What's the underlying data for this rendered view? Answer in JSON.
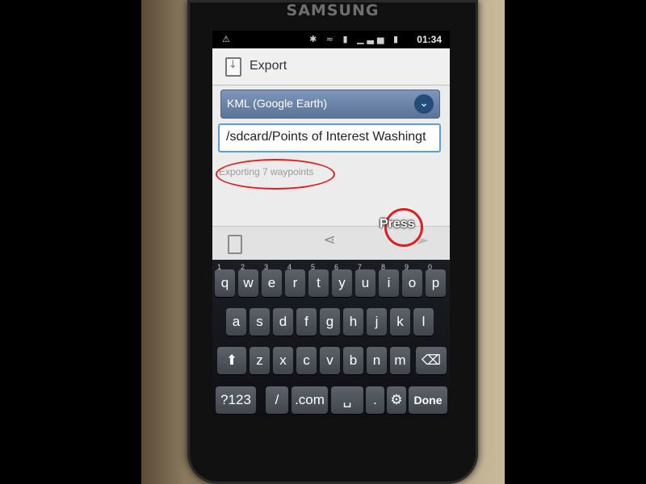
{
  "device": {
    "brand": "SAMSUNG"
  },
  "statusbar": {
    "warning": "⚠",
    "icons": "✱ ≈ ▮ ▁▃▅ ▮",
    "time": "01:34"
  },
  "dialog": {
    "title": "Export",
    "format_select": "KML (Google Earth)",
    "path_value": "/sdcard/Points of Interest Washingt",
    "status": "Exporting 7 waypoints"
  },
  "actions": {
    "share_icon": "⋖",
    "next_icon": "►"
  },
  "annotation": {
    "press_label": "Press",
    "highlight_color": "#e02020"
  },
  "keyboard": {
    "row1": [
      {
        "label": "q",
        "num": "1"
      },
      {
        "label": "w",
        "num": "2"
      },
      {
        "label": "e",
        "num": "3"
      },
      {
        "label": "r",
        "num": "4"
      },
      {
        "label": "t",
        "num": "5"
      },
      {
        "label": "y",
        "num": "6"
      },
      {
        "label": "u",
        "num": "7"
      },
      {
        "label": "i",
        "num": "8"
      },
      {
        "label": "o",
        "num": "9"
      },
      {
        "label": "p",
        "num": "0"
      }
    ],
    "row2": [
      "a",
      "s",
      "d",
      "f",
      "g",
      "h",
      "j",
      "k",
      "l"
    ],
    "row3": [
      "z",
      "x",
      "c",
      "v",
      "b",
      "n",
      "m"
    ],
    "shift": "⬆",
    "backspace": "⌫",
    "sym": "?123",
    "slash": "/",
    "dotcom": ".com",
    "space": "␣",
    "period": ".",
    "settings": "⚙",
    "done": "Done"
  }
}
